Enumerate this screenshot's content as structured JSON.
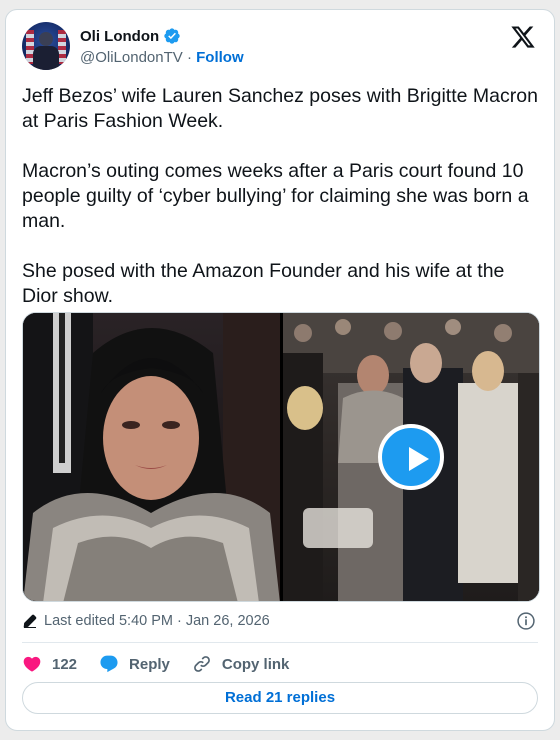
{
  "author": {
    "display_name": "Oli London",
    "handle": "@OliLondonTV",
    "separator": "·",
    "follow_label": "Follow",
    "verified_icon": "verified-badge-icon"
  },
  "tweet": {
    "text": "Jeff Bezos’ wife Lauren Sanchez poses with Brigitte Macron at Paris Fashion Week.\n\nMacron’s outing comes weeks after a Paris court found 10 people guilty of ‘cyber bullying’ for claiming she was born a man.\n\nShe posed with the Amazon Founder and his wife at the Dior show."
  },
  "media": {
    "items": [
      "photo",
      "video"
    ],
    "play_icon": "play-icon"
  },
  "meta": {
    "edited_label": "Last edited 5:40 PM · Jan 26, 2026",
    "info_icon": "info-icon"
  },
  "actions": {
    "likes_count": "122",
    "reply_label": "Reply",
    "copy_link_label": "Copy link"
  },
  "footer": {
    "read_replies_label": "Read 21 replies"
  },
  "colors": {
    "accent": "#1d9bf0",
    "link": "#006fd6",
    "like": "#f91880",
    "muted": "#536471"
  }
}
